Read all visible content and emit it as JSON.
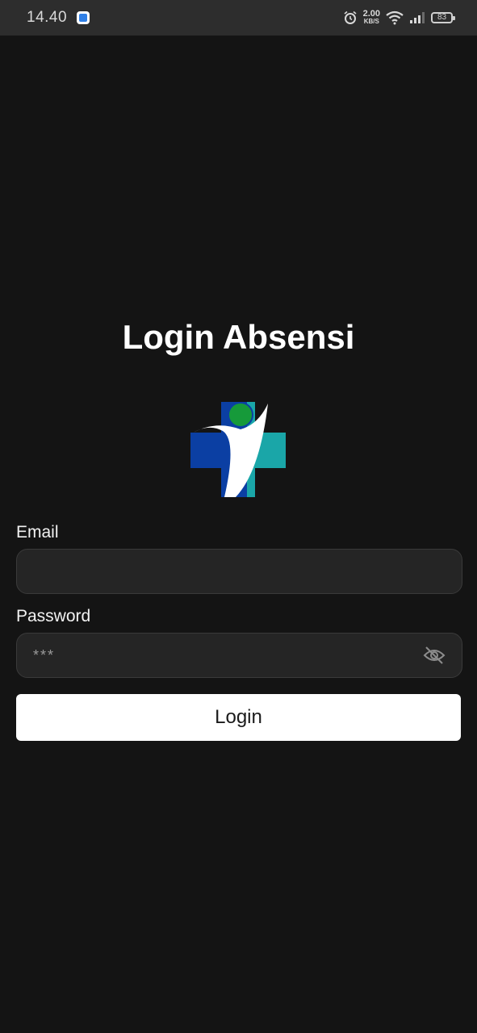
{
  "status_bar": {
    "time": "14.40",
    "network_speed": "2.00",
    "network_unit": "KB/S",
    "battery": "83"
  },
  "page": {
    "title": "Login Absensi"
  },
  "form": {
    "email_label": "Email",
    "email_value": "",
    "password_label": "Password",
    "password_value": "***",
    "login_label": "Login"
  },
  "colors": {
    "background": "#141414",
    "input_bg": "#252525",
    "logo_blue": "#0b3fa3",
    "logo_teal": "#1aa6a8",
    "logo_green": "#169a3a"
  },
  "icons": {
    "password_toggle": "eye-off-icon",
    "logo": "health-cross-logo"
  }
}
